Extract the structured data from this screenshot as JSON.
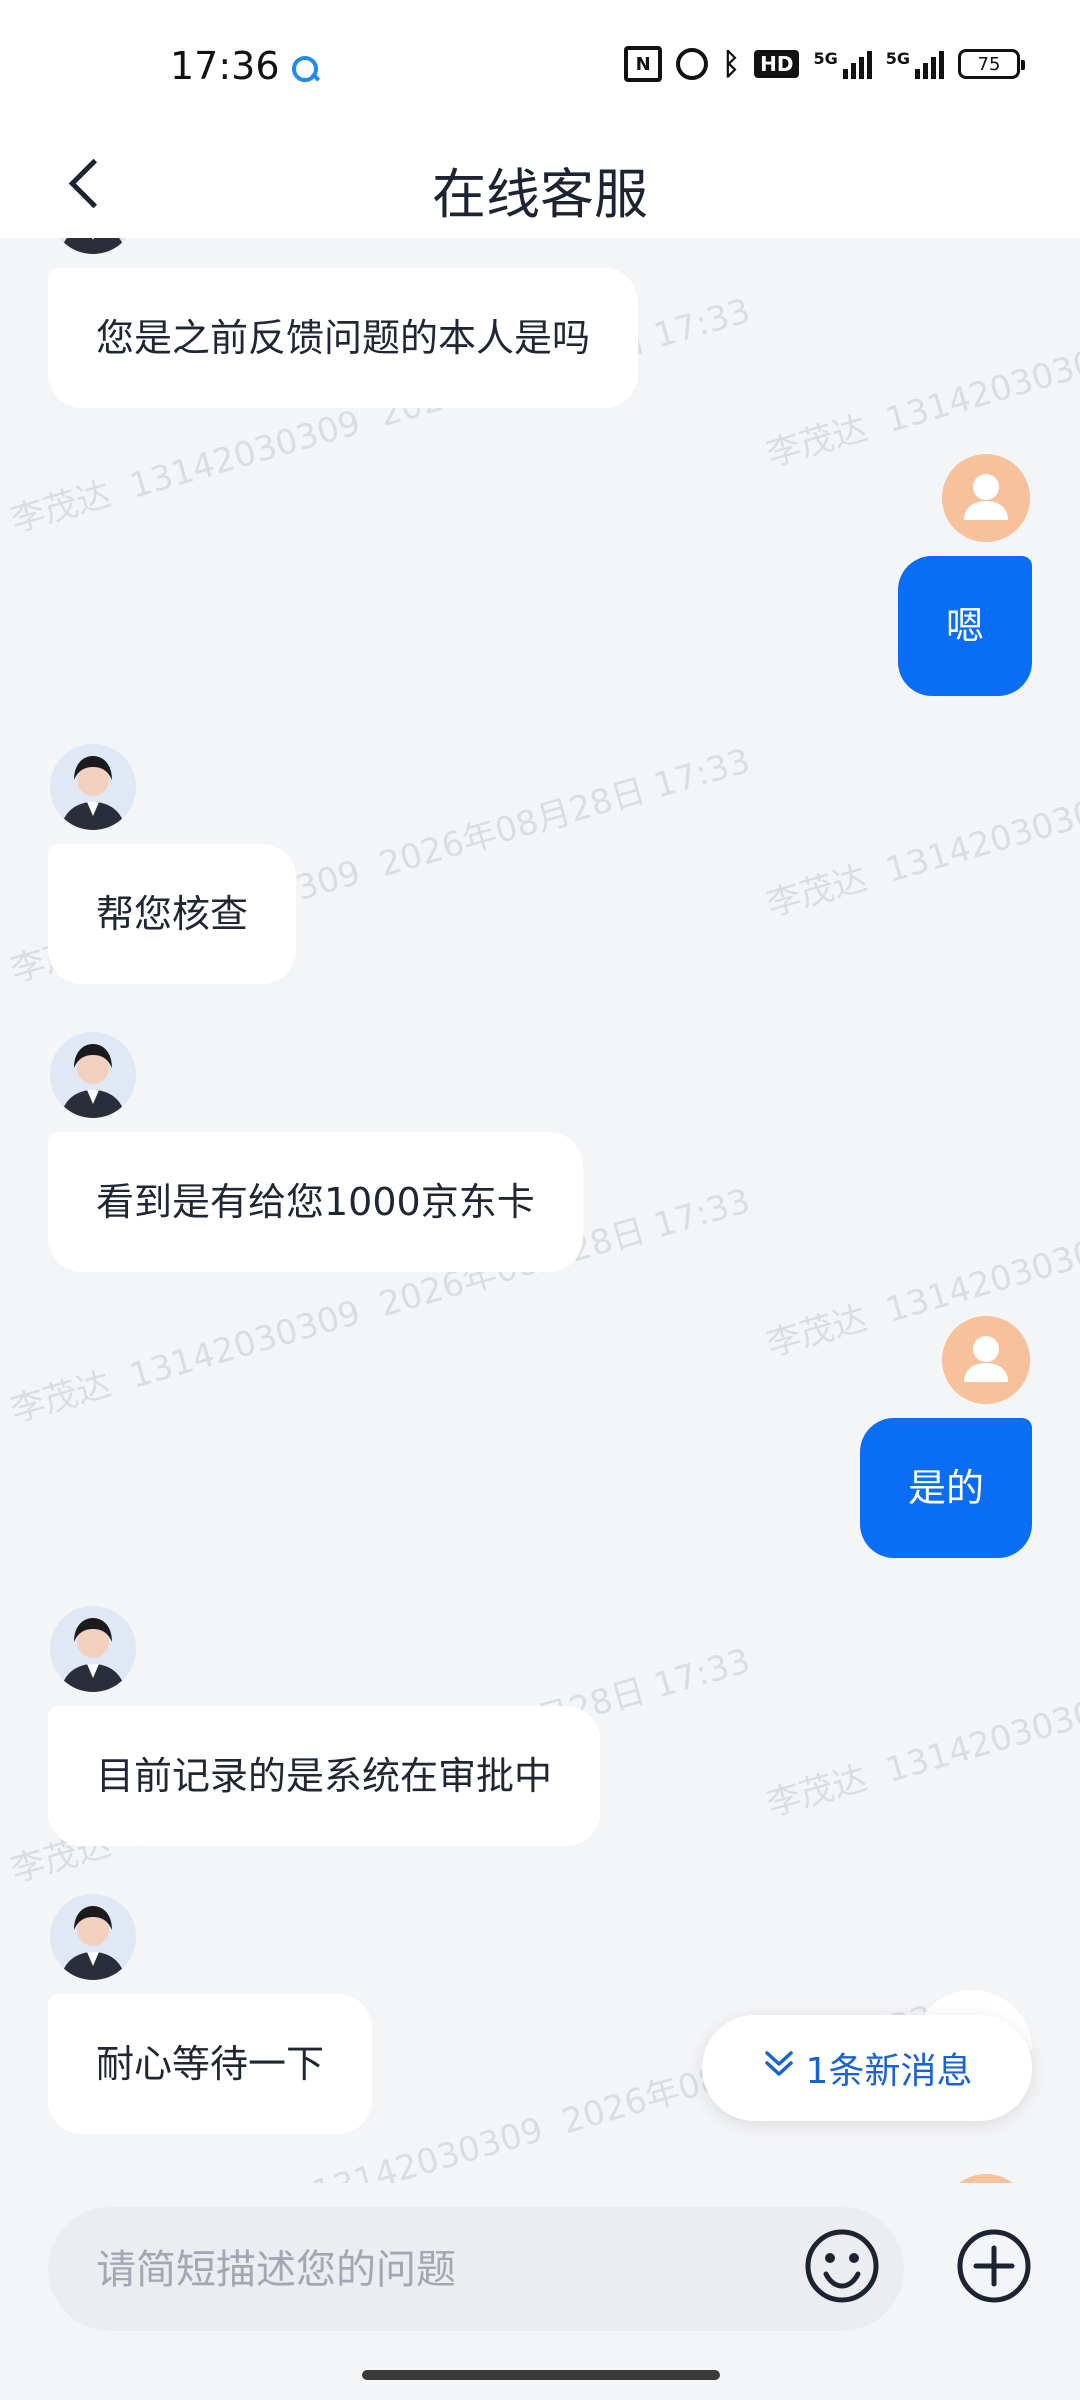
{
  "status_bar": {
    "time": "17:36",
    "network_label": "5G",
    "network_label_2": "5G",
    "battery": "75",
    "hd_label": "HD"
  },
  "header": {
    "title": "在线客服"
  },
  "messages": [
    {
      "side": "agent",
      "text": "您是之前反馈问题的本人是吗"
    },
    {
      "side": "user",
      "text": "嗯"
    },
    {
      "side": "agent",
      "text": "帮您核查"
    },
    {
      "side": "agent",
      "text": "看到是有给您1000京东卡"
    },
    {
      "side": "user",
      "text": "是的"
    },
    {
      "side": "agent",
      "text": "目前记录的是系统在审批中"
    },
    {
      "side": "agent",
      "text": "耐心等待一下"
    }
  ],
  "watermark": {
    "name": "李茂达",
    "phone": "13142030309",
    "date": "2026年08月28日 17:33"
  },
  "new_messages": {
    "label": "1条新消息"
  },
  "input": {
    "placeholder": "请简短描述您的问题"
  },
  "colors": {
    "accent": "#0a6df6",
    "background": "#f4f5f7",
    "user_avatar": "#f7c19b"
  }
}
